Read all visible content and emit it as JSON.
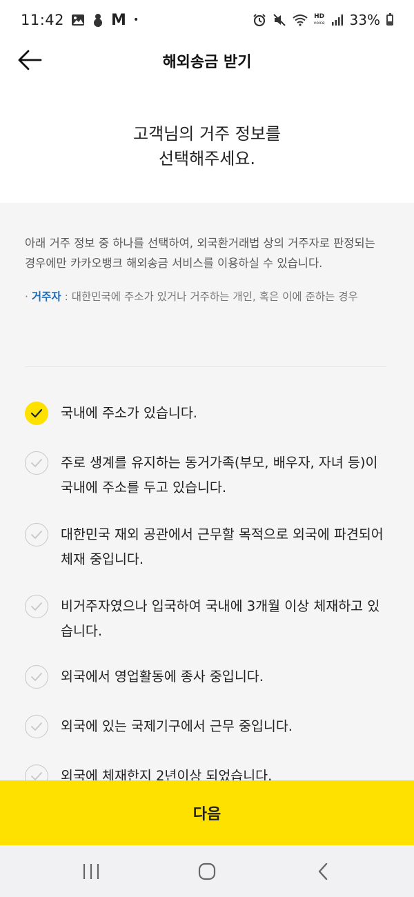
{
  "status_bar": {
    "time": "11:42",
    "carrier_letter": "M",
    "dot": "•",
    "hd_label": "HD",
    "voice_label": "voice",
    "battery": "33%"
  },
  "header": {
    "title": "해외송금 받기"
  },
  "intro": {
    "line1": "고객님의 거주 정보를",
    "line2": "선택해주세요."
  },
  "info": {
    "description": "아래 거주 정보 중 하나를 선택하여, 외국환거래법 상의 거주자로 판정되는 경우에만 카카오뱅크 해외송금 서비스를 이용하실 수 있습니다.",
    "bullet": "· ",
    "note_term": "거주자",
    "note_text": " : 대한민국에 주소가 있거나 거주하는 개인, 혹은 이에 준하는 경우"
  },
  "options": [
    {
      "label": "국내에 주소가 있습니다.",
      "checked": true
    },
    {
      "label": "주로 생계를 유지하는 동거가족(부모, 배우자, 자녀 등)이 국내에 주소를 두고 있습니다.",
      "checked": false
    },
    {
      "label": "대한민국 재외 공관에서 근무할 목적으로 외국에 파견되어 체재 중입니다.",
      "checked": false
    },
    {
      "label": "비거주자였으나 입국하여 국내에 3개월 이상 체재하고 있습니다.",
      "checked": false
    },
    {
      "label": "외국에서 영업활동에 종사 중입니다.",
      "checked": false
    },
    {
      "label": "외국에 있는 국제기구에서 근무 중입니다.",
      "checked": false
    },
    {
      "label": "외국에 체재한지 2년이상 되었습니다.",
      "checked": false
    }
  ],
  "next_button": {
    "label": "다음"
  },
  "colors": {
    "accent": "#ffe100",
    "term": "#1f6bb8"
  }
}
